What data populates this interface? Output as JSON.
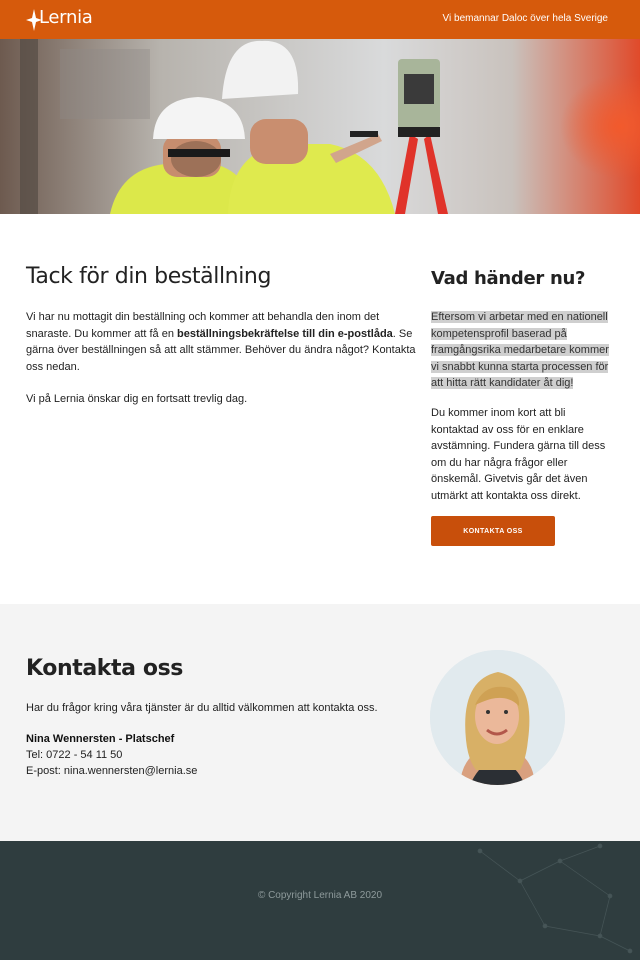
{
  "header": {
    "logo_text": "Lernia",
    "tagline": "Vi bemannar Daloc över hela Sverige",
    "brand_color": "#d65a0c"
  },
  "hero": {
    "image": "two-construction-workers-with-surveying-instrument"
  },
  "thanks": {
    "title": "Tack för din beställning",
    "p1_a": "Vi har nu mottagit din beställning och kommer att behandla den inom det snaraste. Du kommer att få en ",
    "p1_bold": "beställningsbekräftelse till din e-postlåda",
    "p1_b": ". Se gärna över beställningen så att allt stämmer. Behöver du ändra något? Kontakta oss nedan.",
    "p2": "Vi på Lernia önskar dig en fortsatt trevlig dag."
  },
  "next": {
    "title": "Vad händer nu?",
    "highlight": "Eftersom vi arbetar med en nationell kompetensprofil baserad på framgångsrika medarbetare kommer vi snabbt kunna starta processen för att hitta rätt kandidater åt dig!",
    "body": "Du kommer inom kort att bli kontaktad av oss för en enklare avstämning. Fundera gärna till dess om du har några frågor eller önskemål. Givetvis går det även utmärkt att kontakta oss direkt.",
    "cta_label": "KONTAKTA OSS"
  },
  "contact": {
    "title": "Kontakta oss",
    "intro": "Har du frågor kring våra tjänster är du alltid välkommen att kontakta oss.",
    "name": "Nina Wennersten - Platschef",
    "tel": "Tel: 0722 - 54 11 50",
    "email": "E-post:  nina.wennersten@lernia.se"
  },
  "footer": {
    "copyright": "© Copyright Lernia AB 2020",
    "background": "#2f3d3f"
  }
}
